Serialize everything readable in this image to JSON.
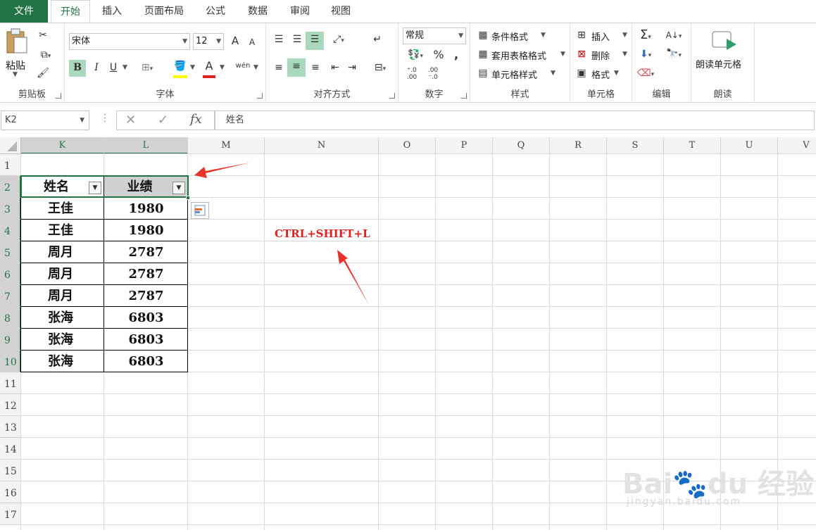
{
  "tabs": [
    "文件",
    "开始",
    "插入",
    "页面布局",
    "公式",
    "数据",
    "审阅",
    "视图"
  ],
  "ribbon": {
    "clipboard": {
      "paste": "粘贴",
      "label": "剪贴板"
    },
    "font": {
      "font_name": "宋体",
      "font_size": "12",
      "bold": "B",
      "italic": "I",
      "underline": "U",
      "grow": "A",
      "shrink": "A",
      "font_color_glyph": "A",
      "phonetic": "wén",
      "label": "字体"
    },
    "align": {
      "label": "对齐方式"
    },
    "number": {
      "format": "常规",
      "percent": "%",
      "comma": ",",
      "inc_decimal": "⁺.0 .00",
      "dec_decimal": ".00 ⁻.0",
      "label": "数字"
    },
    "styles": {
      "conditional": "条件格式",
      "table_format": "套用表格格式",
      "cell_style": "单元格样式",
      "label": "样式"
    },
    "cells": {
      "insert": "插入",
      "delete": "删除",
      "format": "格式",
      "label": "单元格"
    },
    "editing": {
      "sum": "Σ",
      "label": "编辑"
    },
    "read": {
      "read_cell": "朗读单元格",
      "label": "朗读"
    }
  },
  "formula_bar": {
    "name_box": "K2",
    "fx": "fx",
    "content": "姓名"
  },
  "columns": [
    "K",
    "L",
    "M",
    "N",
    "O",
    "P",
    "Q",
    "R",
    "S",
    "T",
    "U",
    "V"
  ],
  "rows": [
    "1",
    "2",
    "3",
    "4",
    "5",
    "6",
    "7",
    "8",
    "9",
    "10",
    "11",
    "12",
    "13",
    "14",
    "15",
    "16",
    "17"
  ],
  "table": {
    "headers": [
      "姓名",
      "业绩"
    ],
    "rows": [
      [
        "王佳",
        "1980"
      ],
      [
        "王佳",
        "1980"
      ],
      [
        "周月",
        "2787"
      ],
      [
        "周月",
        "2787"
      ],
      [
        "周月",
        "2787"
      ],
      [
        "张海",
        "6803"
      ],
      [
        "张海",
        "6803"
      ],
      [
        "张海",
        "6803"
      ]
    ]
  },
  "annotation": {
    "text": "CTRL+SHIFT+L",
    "color": "#e0201f"
  },
  "colors": {
    "accent": "#217346",
    "annotation_red": "#e0201f"
  }
}
